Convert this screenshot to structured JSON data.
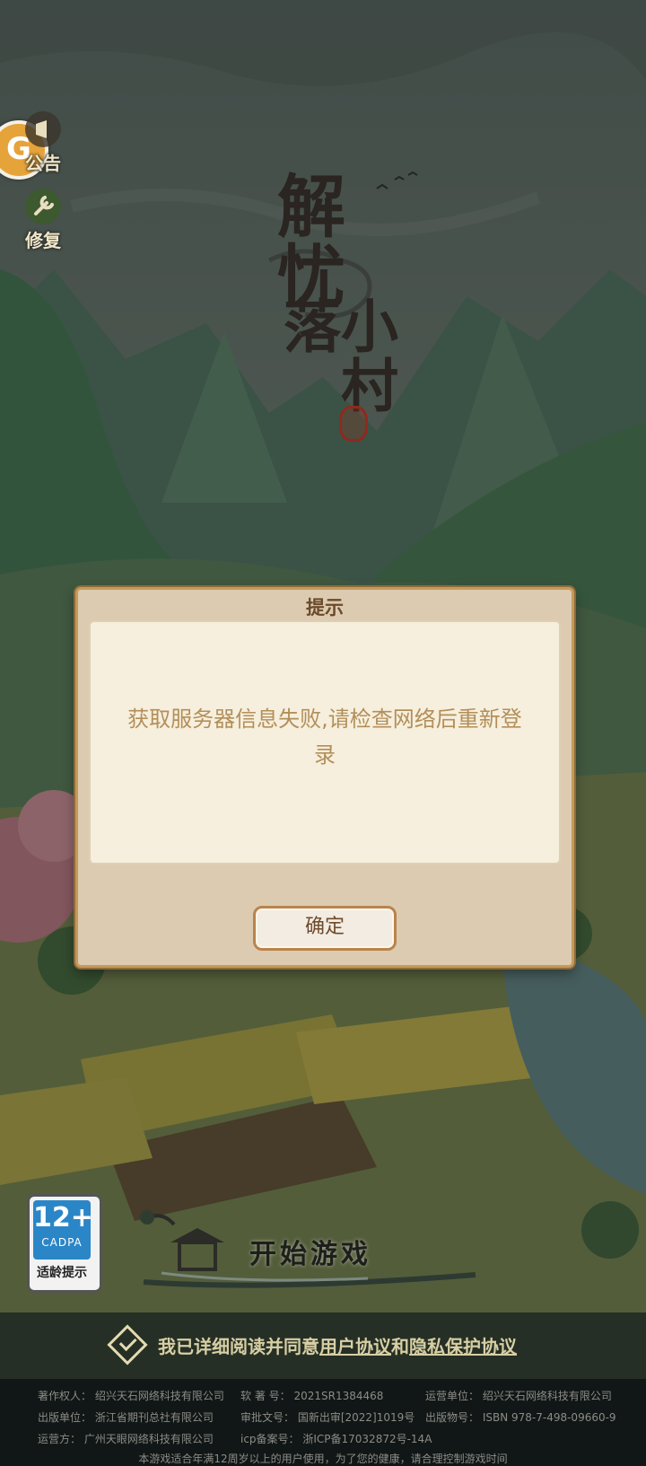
{
  "side_buttons": {
    "notice_label": "公告",
    "repair_label": "修复"
  },
  "game_title": {
    "line1": "解忧",
    "line2": "小村落"
  },
  "dialog": {
    "title": "提示",
    "message": "获取服务器信息失败,请检查网络后重新登录",
    "ok_label": "确定"
  },
  "age_rating": {
    "number": "12+",
    "org": "CADPA",
    "tip": "适龄提示"
  },
  "start_button": {
    "label": "开始游戏"
  },
  "agreement": {
    "prefix": "我已详细阅读并同意",
    "user_agreement": "用户协议",
    "and": "和",
    "privacy_agreement": "隐私保护协议"
  },
  "footer": {
    "copyright": "著作权人：  绍兴天石网络科技有限公司",
    "software_reg": "软  著  号：  2021SR1384468",
    "operator": "运营单位：  绍兴天石网络科技有限公司",
    "publisher": "出版单位：  浙江省期刊总社有限公司",
    "approval": "审批文号：  国新出审[2022]1019号",
    "isbn": "出版物号：  ISBN 978-7-498-09660-9",
    "operator2": "运营方：  广州天眼网络科技有限公司",
    "icp": "icp备案号：  浙ICP备17032872号-14A",
    "health_note": "本游戏适合年满12周岁以上的用户使用，为了您的健康，请合理控制游戏时间"
  },
  "colors": {
    "dialog_bg": "#dccbb0",
    "panel_bg": "#f6efdd",
    "message_text": "#b38f5a",
    "accent_border": "#c49a5b",
    "age_badge_blue": "#2b86c7"
  }
}
